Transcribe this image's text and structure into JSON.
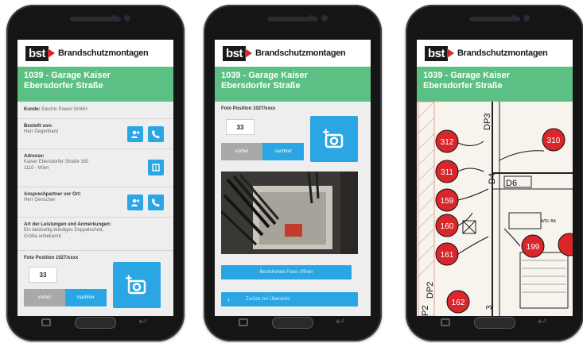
{
  "brand": {
    "logo": "bst",
    "name": "Brandschutzmontagen"
  },
  "project": {
    "title_line1": "1039 - Garage Kaiser",
    "title_line2": "Ebersdorfer Straße"
  },
  "phone1": {
    "kunde_label": "Kunde:",
    "kunde_value": "Electric Power GmbH",
    "bestellt_label": "Bestellt von:",
    "bestellt_value": "Herr Degenhard",
    "adresse_label": "Adresse:",
    "adresse_line1": "Kaiser Ebersdorfer Straße 162",
    "adresse_line2": "1110 - Wien",
    "ansprech_label": "Ansprechpartner vor Ort:",
    "ansprech_value": "Herr Genscher",
    "leistungen_label": "Art der Leistungen und Anmerkungen:",
    "leistungen_line1": "Ein beidseitig bündiges Doppelschott,",
    "leistungen_line2": "Größe unbekannt",
    "foto_label": "Foto Position 1027/xxxx",
    "position_number": "33",
    "prev_label": "vorher",
    "next_label": "nachher"
  },
  "phone2": {
    "foto_label": "Foto Position 1027/xxxx",
    "position_number": "33",
    "prev_label": "vorher",
    "next_label": "nachher",
    "open_photos_label": "Bestehende Fotos öffnen",
    "back_label": "Zurück zur Übersicht"
  },
  "phone3": {
    "markers": [
      {
        "label": "312"
      },
      {
        "label": "310"
      },
      {
        "label": "311"
      },
      {
        "label": "159"
      },
      {
        "label": "160"
      },
      {
        "label": "199"
      },
      {
        "label": "161"
      },
      {
        "label": "162"
      }
    ],
    "plan_labels": [
      "DP3",
      "D4",
      "D6",
      "DP2",
      "P2",
      "3",
      "WDL BA"
    ]
  },
  "colors": {
    "accent_blue": "#29a6e3",
    "header_green": "#5cc084",
    "marker_red": "#d9262b",
    "logo_red": "#d9262b"
  },
  "icons": [
    "add-contact-icon",
    "phone-icon",
    "map-icon",
    "camera-add-icon",
    "back-arrow-icon"
  ]
}
